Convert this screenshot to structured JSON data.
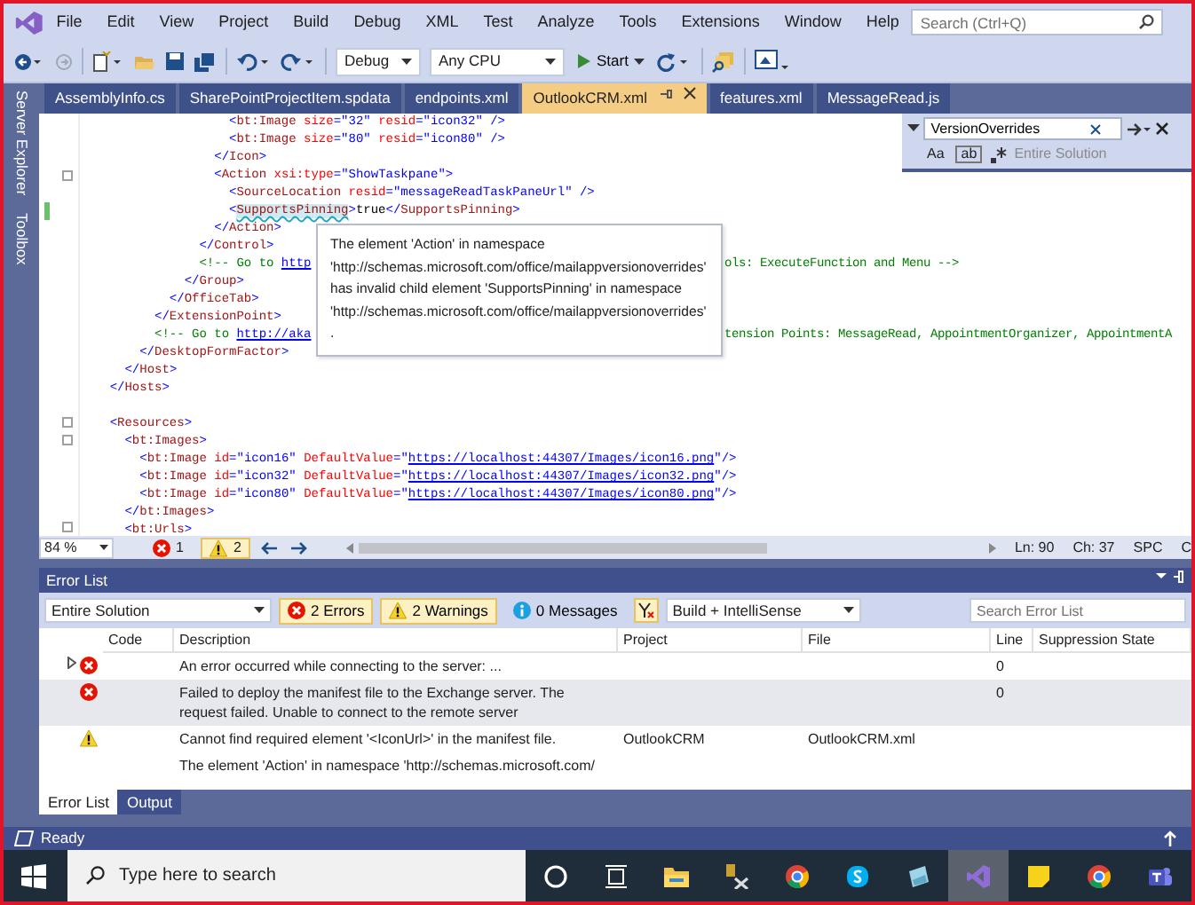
{
  "menu": {
    "items": [
      "File",
      "Edit",
      "View",
      "Project",
      "Build",
      "Debug",
      "XML",
      "Test",
      "Analyze",
      "Tools",
      "Extensions",
      "Window",
      "Help"
    ],
    "search_placeholder": "Search (Ctrl+Q)"
  },
  "toolbar": {
    "configuration": "Debug",
    "platform": "Any CPU",
    "start": "Start"
  },
  "sidebar": [
    "Server Explorer",
    "Toolbox"
  ],
  "tabs": [
    {
      "label": "AssemblyInfo.cs",
      "selected": false
    },
    {
      "label": "SharePointProjectItem.spdata",
      "selected": false
    },
    {
      "label": "endpoints.xml",
      "selected": false
    },
    {
      "label": "OutlookCRM.xml",
      "selected": true
    },
    {
      "label": "features.xml",
      "selected": false
    },
    {
      "label": "MessageRead.js",
      "selected": false
    }
  ],
  "find": {
    "value": "VersionOverrides",
    "options": [
      "Aa",
      "ab"
    ],
    "scope": "Entire Solution"
  },
  "code": [
    {
      "kind": "xml",
      "text": "                    <bt:Image size=\"32\" resid=\"icon32\" />"
    },
    {
      "kind": "xml",
      "text": "                    <bt:Image size=\"80\" resid=\"icon80\" />"
    },
    {
      "kind": "xml",
      "text": "                  </Icon>"
    },
    {
      "kind": "xml",
      "text": "                  <Action xsi:type=\"ShowTaskpane\">",
      "fold": true
    },
    {
      "kind": "xml",
      "text": "                    <SourceLocation resid=\"messageReadTaskPaneUrl\" />"
    },
    {
      "kind": "xml",
      "text": "                    <SupportsPinning>true</SupportsPinning>",
      "error_tag": true,
      "changed": true
    },
    {
      "kind": "xml",
      "text": "                  </Action>"
    },
    {
      "kind": "xml",
      "text": "                </Control>"
    },
    {
      "kind": "comment",
      "text": "                <!-- Go to ",
      "link": "http",
      "after": "ols: ExecuteFunction and Menu -->"
    },
    {
      "kind": "xml",
      "text": "              </Group>"
    },
    {
      "kind": "xml",
      "text": "            </OfficeTab>"
    },
    {
      "kind": "xml",
      "text": "          </ExtensionPoint>"
    },
    {
      "kind": "comment",
      "text": "          <!-- Go to ",
      "link": "http://aka",
      "after": "tension Points: MessageRead, AppointmentOrganizer, AppointmentA"
    },
    {
      "kind": "xml",
      "text": "        </DesktopFormFactor>"
    },
    {
      "kind": "xml",
      "text": "      </Host>"
    },
    {
      "kind": "xml",
      "text": "    </Hosts>"
    },
    {
      "kind": "blank"
    },
    {
      "kind": "xml",
      "text": "    <Resources>",
      "fold": true
    },
    {
      "kind": "xml",
      "text": "      <bt:Images>",
      "fold": true
    },
    {
      "kind": "xml",
      "text": "        <bt:Image id=\"icon16\" DefaultValue=\"",
      "link": "https://localhost:44307/Images/icon16.png",
      "tail": "\"/>"
    },
    {
      "kind": "xml",
      "text": "        <bt:Image id=\"icon32\" DefaultValue=\"",
      "link": "https://localhost:44307/Images/icon32.png",
      "tail": "\"/>"
    },
    {
      "kind": "xml",
      "text": "        <bt:Image id=\"icon80\" DefaultValue=\"",
      "link": "https://localhost:44307/Images/icon80.png",
      "tail": "\"/>"
    },
    {
      "kind": "xml",
      "text": "      </bt:Images>"
    },
    {
      "kind": "xml",
      "text": "      <bt:Urls>",
      "fold": true
    }
  ],
  "tooltip": "The element 'Action' in namespace 'http://schemas.microsoft.com/office/mailappversionoverrides' has invalid child element 'SupportsPinning' in namespace 'http://schemas.microsoft.com/office/mailappversionoverrides'.",
  "editor_status": {
    "zoom": "84 %",
    "errors": "1",
    "warnings": "2",
    "line": "Ln: 90",
    "column": "Ch: 37",
    "whitespace": "SPC",
    "line_ending": "C"
  },
  "error_list": {
    "title": "Error List",
    "scope": "Entire Solution",
    "filters": [
      {
        "kind": "error",
        "label": "2 Errors",
        "selected": true
      },
      {
        "kind": "warning",
        "label": "2 Warnings",
        "selected": true
      },
      {
        "kind": "info",
        "label": "0 Messages",
        "selected": false
      }
    ],
    "source": "Build + IntelliSense",
    "search_placeholder": "Search Error List",
    "columns": [
      "Code",
      "Description",
      "Project",
      "File",
      "Line",
      "Suppression State"
    ],
    "rows": [
      {
        "kind": "error",
        "expandable": true,
        "selected": false,
        "description": "An error occurred while connecting to the server:  ...",
        "line": "0"
      },
      {
        "kind": "error",
        "expandable": false,
        "selected": true,
        "description": "Failed to deploy the manifest file to the Exchange server.  The request failed. Unable to connect to the remote server",
        "line": "0"
      },
      {
        "kind": "warning",
        "expandable": false,
        "selected": false,
        "description": "Cannot find required element '<IconUrl>' in the manifest file.",
        "project": "OutlookCRM",
        "file": "OutlookCRM.xml"
      },
      {
        "expandable": false,
        "selected": false,
        "description": "The element 'Action' in namespace 'http://schemas.microsoft.com/"
      }
    ],
    "tabs": [
      {
        "label": "Error List",
        "selected": true
      },
      {
        "label": "Output",
        "selected": false
      }
    ]
  },
  "status_bar": "Ready",
  "taskbar": {
    "search_placeholder": "Type here to search",
    "apps": [
      {
        "kind": "cortana",
        "selected": false
      },
      {
        "kind": "taskview",
        "selected": false
      },
      {
        "kind": "folder",
        "selected": false
      },
      {
        "kind": "tools",
        "selected": false
      },
      {
        "kind": "browser",
        "selected": false
      },
      {
        "kind": "chat",
        "selected": false
      },
      {
        "kind": "photos",
        "selected": false
      },
      {
        "kind": "studio",
        "selected": true
      },
      {
        "kind": "notes",
        "selected": false
      },
      {
        "kind": "browser",
        "selected": false
      },
      {
        "kind": "teams",
        "selected": false
      }
    ]
  }
}
